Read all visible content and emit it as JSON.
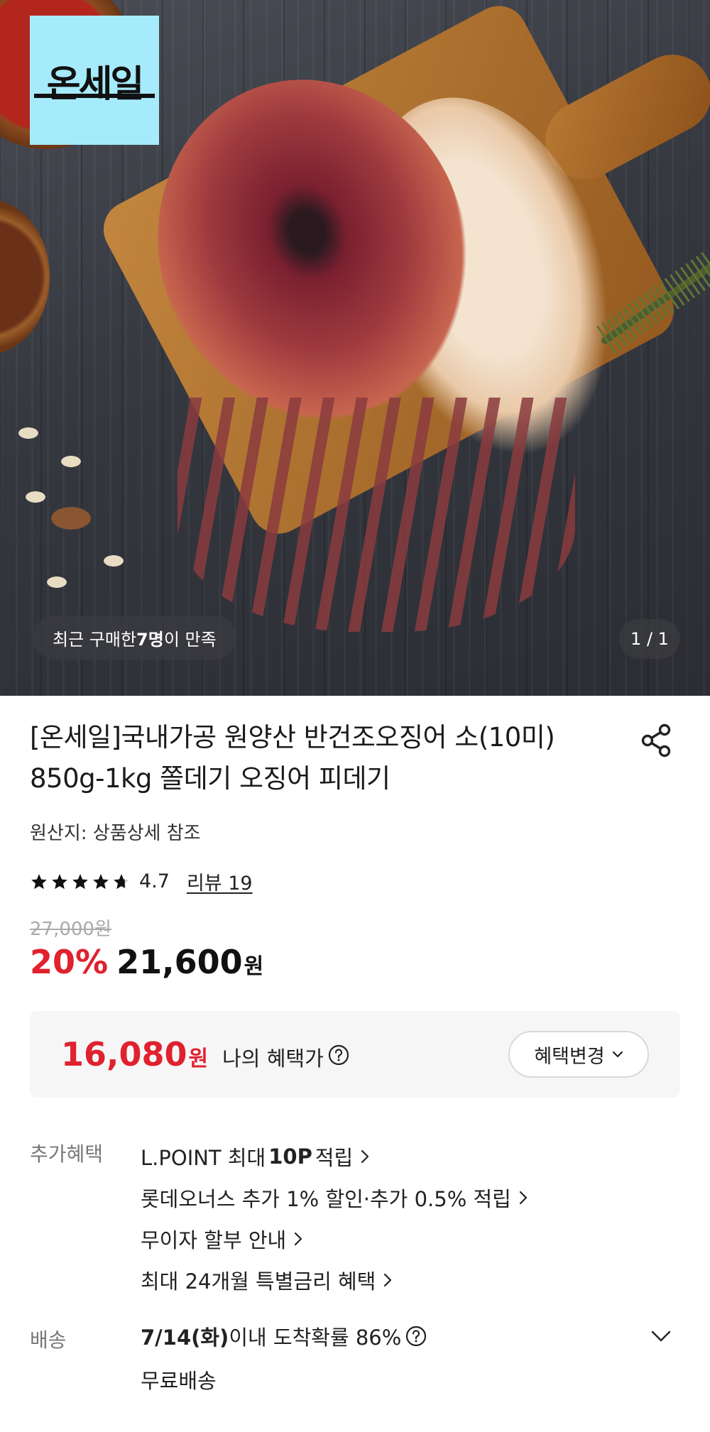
{
  "hero": {
    "logo_text": "온세일",
    "buyers_prefix": "최근 구매한 ",
    "buyers_count": "7명",
    "buyers_suffix": "이 만족",
    "page_indicator": "1 / 1"
  },
  "product": {
    "title": "[온세일]국내가공 원양산 반건조오징어 소(10미) 850g-1kg 쫄데기 오징어 피데기",
    "origin": "원산지: 상품상세 참조",
    "rating": 4.7,
    "rating_text": "4.7",
    "review_text": "리뷰 19",
    "original_price": "27,000원",
    "discount_rate": "20%",
    "sale_price": "21,600",
    "sale_unit": "원"
  },
  "benefit": {
    "price": "16,080",
    "unit": "원",
    "label": "나의 혜택가",
    "change_button": "혜택변경"
  },
  "extra_benefits": {
    "label": "추가혜택",
    "items": [
      {
        "pre": "L.POINT 최대 ",
        "bold": "10P",
        "post": " 적립"
      },
      {
        "pre": "롯데오너스 추가 1% 할인·추가 0.5% 적립",
        "bold": "",
        "post": ""
      },
      {
        "pre": "무이자 할부 안내",
        "bold": "",
        "post": ""
      },
      {
        "pre": "최대 24개월 특별금리 혜택",
        "bold": "",
        "post": ""
      }
    ]
  },
  "delivery": {
    "label": "배송",
    "date": "7/14(화)",
    "probability_text": " 이내 도착확률 86%",
    "fee": "무료배송"
  },
  "colors": {
    "accent_red": "#e0212e",
    "logo_bg": "#a6ebfb"
  }
}
